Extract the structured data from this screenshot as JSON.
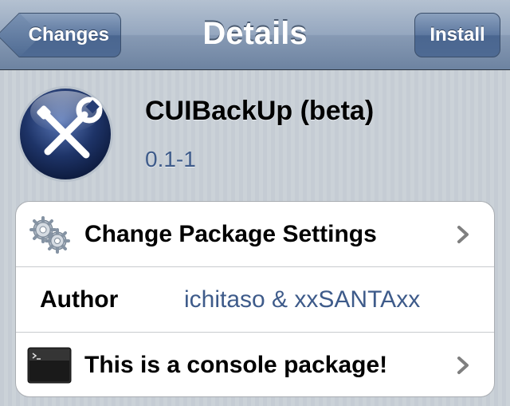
{
  "navbar": {
    "title": "Details",
    "back_label": "Changes",
    "install_label": "Install"
  },
  "package": {
    "name": "CUIBackUp (beta)",
    "version": "0.1-1",
    "icon": "wrench-screwdriver-icon"
  },
  "rows": {
    "settings": {
      "label": "Change Package Settings",
      "icon": "gears-icon"
    },
    "author": {
      "label": "Author",
      "value": "ichitaso & xxSANTAxx"
    },
    "console": {
      "label": "This is a console package!",
      "icon": "terminal-icon"
    }
  },
  "colors": {
    "navbar": "#6d83a1",
    "background": "#c5ccd4",
    "accent_text": "#3e5b8a"
  }
}
